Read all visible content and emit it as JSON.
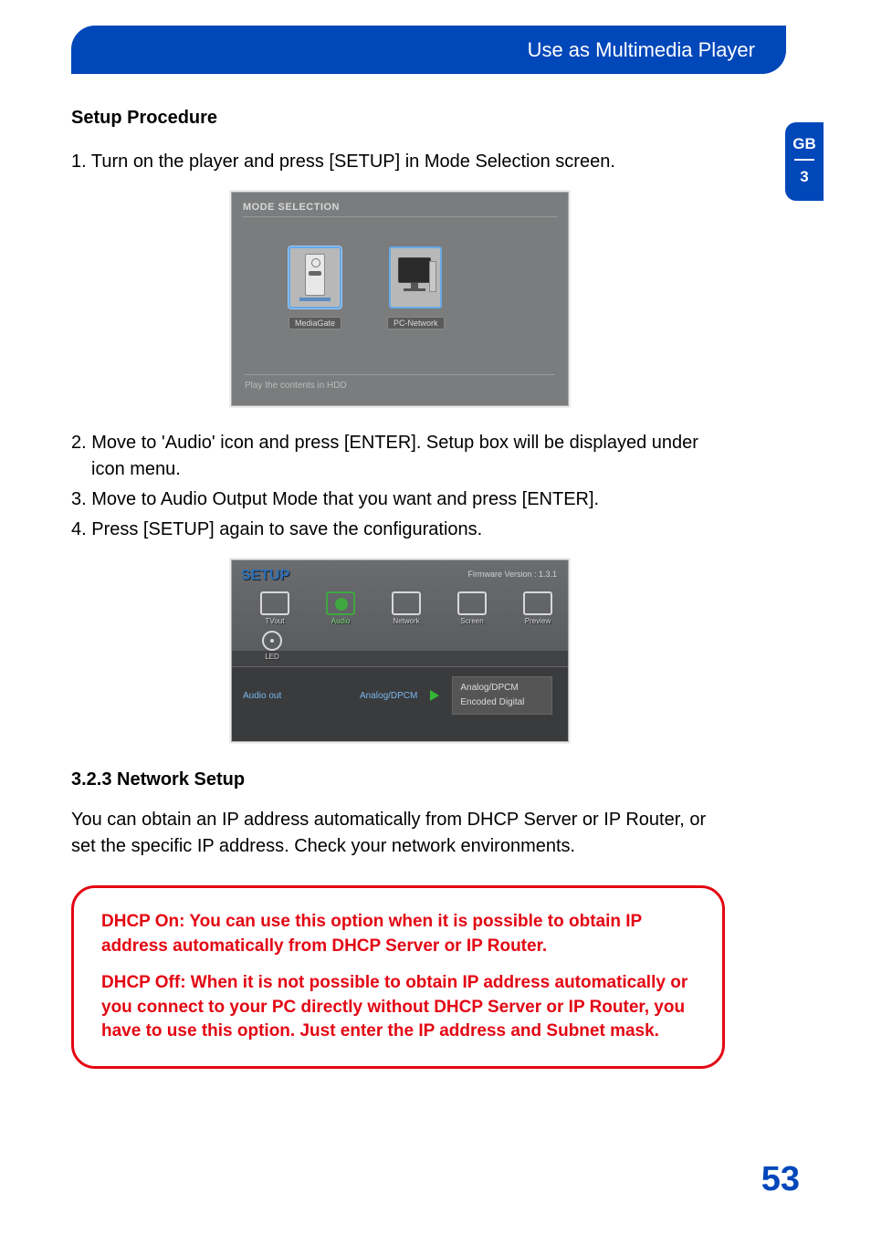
{
  "header": {
    "title": "Use as Multimedia Player"
  },
  "sideTab": {
    "lang": "GB",
    "chapter": "3"
  },
  "sections": {
    "setup_heading": "Setup Procedure",
    "steps_a": [
      "1. Turn on the player and press [SETUP] in Mode Selection screen."
    ],
    "steps_b": [
      "2. Move to 'Audio' icon and press [ENTER]. Setup box will be displayed under icon menu.",
      "3. Move to Audio Output Mode that you want and press [ENTER].",
      "4. Press [SETUP] again to save the configurations."
    ],
    "network_heading": "3.2.3 Network Setup",
    "network_body": "You can obtain an IP address automatically from DHCP Server or IP Router, or set the specific IP address. Check your network environments."
  },
  "screenshot1": {
    "title": "MODE SELECTION",
    "items": [
      {
        "label": "MediaGate"
      },
      {
        "label": "PC-Network"
      }
    ],
    "footer": "Play the contents in HDD"
  },
  "screenshot2": {
    "title": "SETUP",
    "firmware": "Firmware Version : 1.3.1",
    "icons": [
      {
        "label": "TVout"
      },
      {
        "label": "Audio"
      },
      {
        "label": "Network"
      },
      {
        "label": "Screen"
      },
      {
        "label": "Preview"
      }
    ],
    "icon_led": "LED",
    "row_label": "Audio out",
    "row_value": "Analog/DPCM",
    "options": [
      "Analog/DPCM",
      "Encoded Digital"
    ]
  },
  "callout": {
    "p1": "DHCP On: You can use this option when it is possible to obtain IP address automatically from DHCP Server or IP Router.",
    "p2": "DHCP Off: When it is not possible to obtain IP address automatically or you connect to your PC directly without DHCP Server or IP Router, you have to use this option. Just enter the IP address and Subnet mask."
  },
  "pageNumber": "53"
}
